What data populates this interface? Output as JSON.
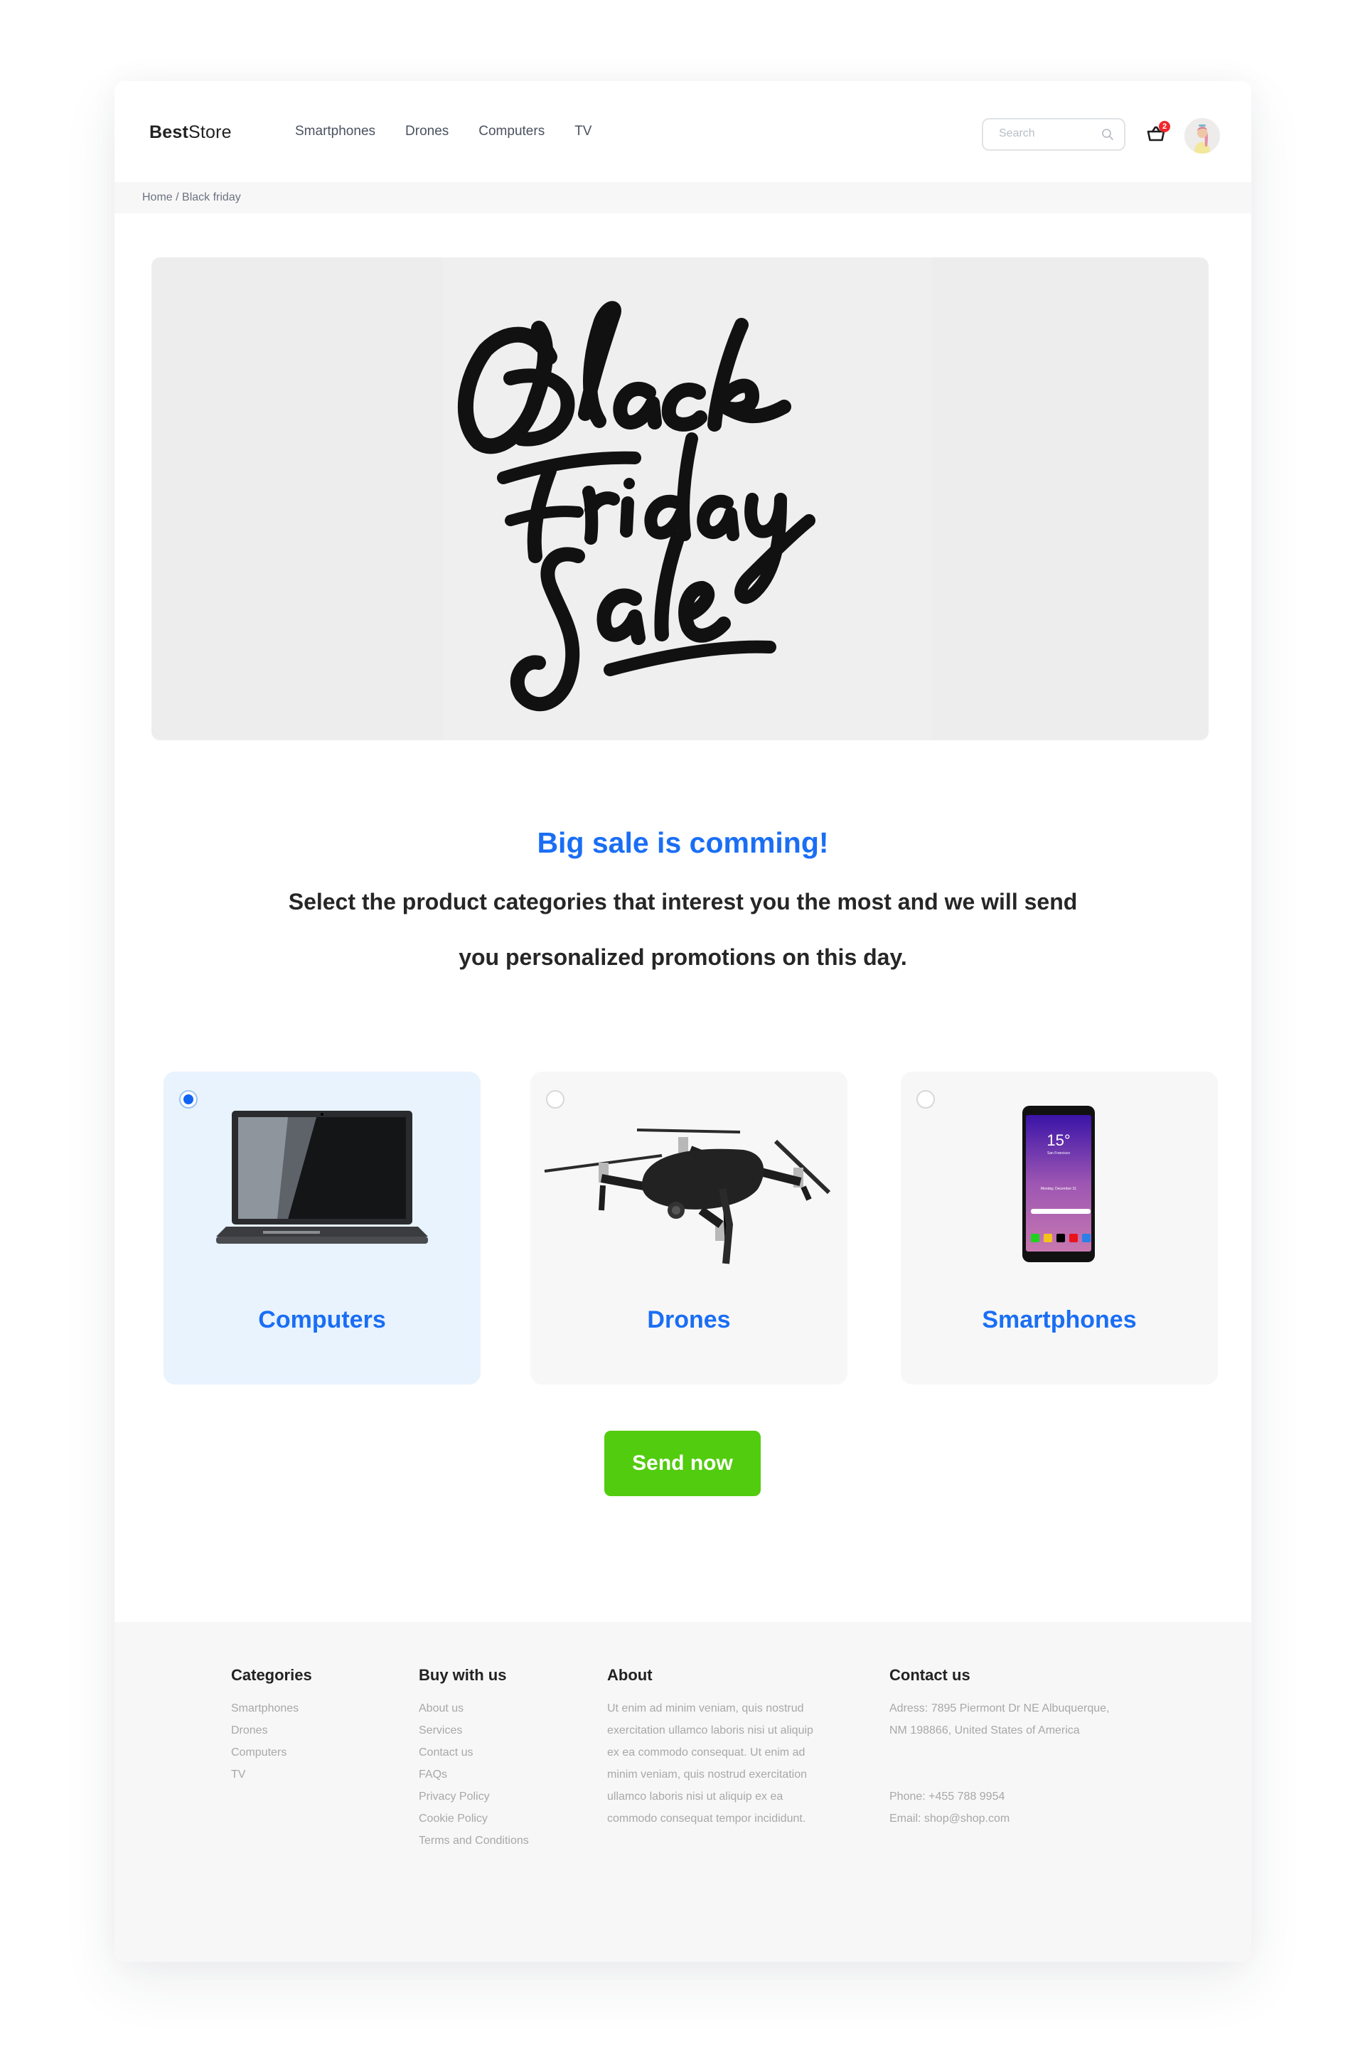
{
  "header": {
    "logo_bold": "Best",
    "logo_regular": "Store",
    "nav": [
      "Smartphones",
      "Drones",
      "Computers",
      "TV"
    ],
    "search_placeholder": "Search",
    "search_value": "",
    "cart_count": "2"
  },
  "breadcrumb": {
    "home": "Home",
    "separator": " / ",
    "current": "Black friday"
  },
  "hero": {
    "art_lines": [
      "Black",
      "Friday",
      "Sale"
    ]
  },
  "main": {
    "title": "Big sale is comming!",
    "subtitle_line1": "Select the product categories that interest you the most and we will send",
    "subtitle_line2": "you personalized promotions on this day.",
    "categories": [
      {
        "label": "Computers",
        "selected": true,
        "image": "laptop"
      },
      {
        "label": "Drones",
        "selected": false,
        "image": "drone"
      },
      {
        "label": "Smartphones",
        "selected": false,
        "image": "smartphone"
      }
    ],
    "phone_screen": {
      "temp": "15°",
      "city": "San Francisco",
      "date": "Monday, December 31"
    },
    "send_label": "Send now"
  },
  "footer": {
    "categories": {
      "title": "Categories",
      "items": [
        "Smartphones",
        "Drones",
        "Computers",
        "TV"
      ]
    },
    "buy": {
      "title": "Buy with us",
      "items": [
        "About us",
        "Services",
        "Contact us",
        "FAQs",
        "Privacy Policy",
        "Cookie Policy",
        "Terms and Conditions"
      ]
    },
    "about": {
      "title": "About",
      "lines": [
        "Ut enim ad minim veniam, quis nostrud",
        "exercitation ullamco laboris nisi ut aliquip",
        "ex ea commodo consequat. Ut enim ad",
        "minim veniam, quis nostrud exercitation",
        "ullamco laboris nisi ut aliquip ex ea",
        "commodo consequat tempor incididunt."
      ]
    },
    "contact": {
      "title": "Contact us",
      "address_line1": "Adress: 7895 Piermont Dr NE Albuquerque,",
      "address_line2": "NM 198866, United States of America",
      "phone": "Phone: +455 788 9954",
      "email": "Email: shop@shop.com"
    }
  },
  "colors": {
    "accent": "#1a6ef5",
    "send_button": "#52cc0e",
    "badge": "#f0262b",
    "selected_card": "#e8f3fe",
    "card": "#f7f7f7"
  }
}
